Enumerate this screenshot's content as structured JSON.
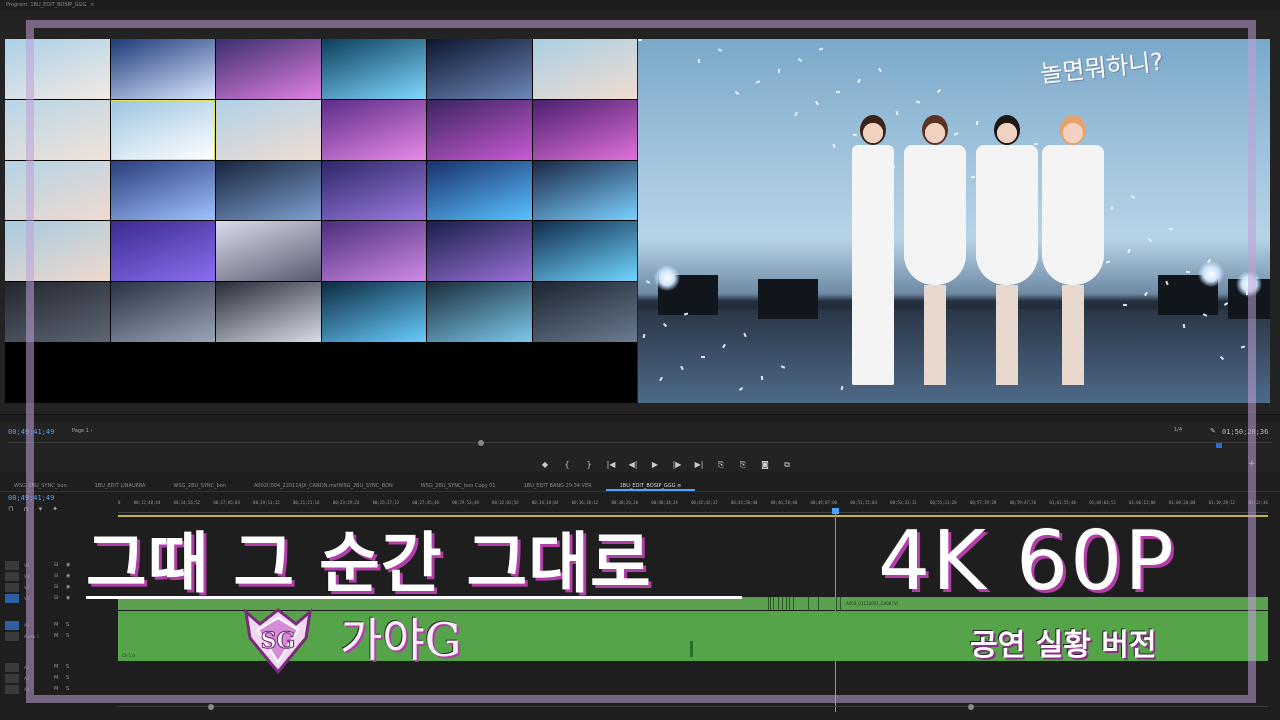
{
  "program_monitor": {
    "title": "Program: 1BU_EDIT_BOSIP_GGG",
    "menu_glyph": "≡",
    "timecode": "00;49;41;49",
    "page": "Page 1",
    "fit": "1/4",
    "duration": "01;50;28;36",
    "video_logo": "놀면뭐하니?"
  },
  "transport": [
    "◆",
    "{",
    "}",
    "|◀",
    "◀|",
    "▶",
    "|▶",
    "▶|",
    "⎘",
    "⎘",
    "◙",
    "⧉"
  ],
  "timeline": {
    "tabs": [
      {
        "label": "WSG_2BU_SYNC_bon",
        "active": false
      },
      {
        "label": "1BU_EDIT LINAU68A",
        "active": false
      },
      {
        "label": "WSG_2BU_SYNC_bon",
        "active": false
      },
      {
        "label": "A002C004_220114JX_CANON.mxfWSG_2BU_SYNC_BON",
        "active": false
      },
      {
        "label": "WSG_2BU_SYNC_bon Copy 01",
        "active": false
      },
      {
        "label": "1BU_EDIT BANG 20:34 VER",
        "active": false
      },
      {
        "label": "1BU_EDIT_BOSIP_GGG ≡",
        "active": true
      }
    ],
    "timecode": "00;49;41;49",
    "ruler": [
      "0",
      "00;12;48;44",
      "00;14;56;52",
      "00;17;05;04",
      "00;19;13;12",
      "00;21;21;16",
      "00;23;29;24",
      "00;25;37;32",
      "00;27;45;40",
      "00;29;53;48",
      "00;32;01;56",
      "00;34;10;04",
      "00;36;18;12",
      "00;38;26;20",
      "00;40;34;24",
      "00;42;42;32",
      "00;44;50;40",
      "00;46;58;48",
      "00;49;07;00",
      "00;51;15;04",
      "00;53;23;12",
      "00;55;31;20",
      "00;57;39;28",
      "00;59;47;36",
      "01;01;55;40",
      "01;04;03;52",
      "01;06;12;00",
      "01;08;20;08",
      "01;10;28;12",
      "01;12;36"
    ],
    "tracks": [
      {
        "name": "V4",
        "patch": false
      },
      {
        "name": "V3",
        "patch": false
      },
      {
        "name": "V2",
        "patch": false
      },
      {
        "name": "V1",
        "patch": true
      },
      {
        "name": "A1",
        "patch": true
      },
      {
        "name": "Audio 1",
        "patch": false
      },
      {
        "name": "A2",
        "patch": false
      },
      {
        "name": "A3",
        "patch": false
      },
      {
        "name": "A4",
        "patch": false
      }
    ],
    "clip_labels": [
      "A003_01112001_C008 [V]",
      "Ch 1.0"
    ]
  },
  "overlay": {
    "title": "그때 그 순간 그대로",
    "spec": "4K 60P",
    "subtitle": "공연 실황 버전",
    "brand": "가야G"
  },
  "colors": {
    "accent_blue": "#4da3ff",
    "clip_green": "#5aa04f",
    "title_shadow": "#b23ea8",
    "frame": "#bea0d7"
  },
  "icons": [
    "wrench-icon",
    "snap-icon",
    "link-icon",
    "marker-icon",
    "settings-icon",
    "lock-icon",
    "eye-icon",
    "mute-icon",
    "solo-icon",
    "plus-icon"
  ]
}
